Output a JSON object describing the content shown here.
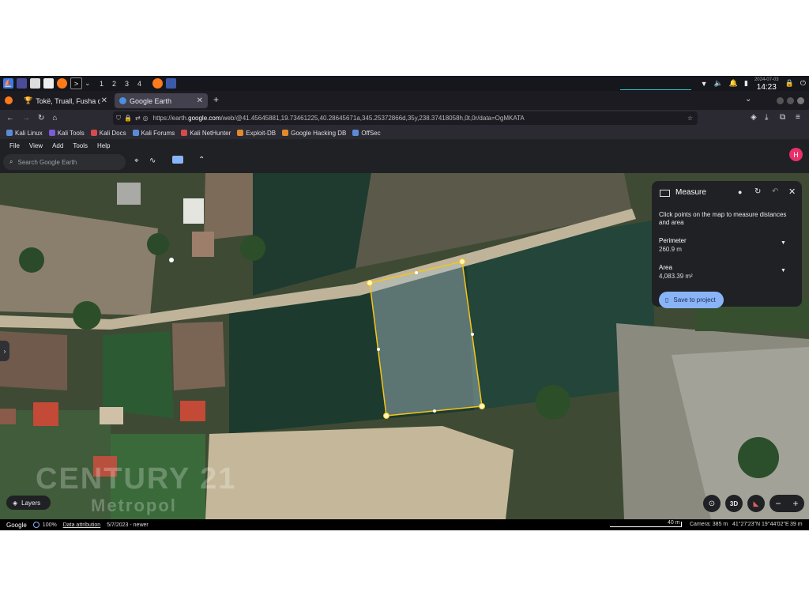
{
  "taskbar": {
    "workspaces": [
      "1",
      "2",
      "3",
      "4"
    ],
    "date": "2024-07-03",
    "time": "14:23"
  },
  "tabs": [
    {
      "label": "Tokë, Truall, Fusha dhe F"
    },
    {
      "label": "Google Earth"
    }
  ],
  "url": {
    "prefix": "https://earth.",
    "domain": "google.com",
    "rest": "/web/@41.45645881,19.73461225,40.28645671a,345.25372866d,35y,238.37418058h,0t,0r/data=OgMKATA"
  },
  "bookmarks": [
    "Kali Linux",
    "Kali Tools",
    "Kali Docs",
    "Kali Forums",
    "Kali NetHunter",
    "Exploit-DB",
    "Google Hacking DB",
    "OffSec"
  ],
  "menu": [
    "File",
    "View",
    "Add",
    "Tools",
    "Help"
  ],
  "search": {
    "placeholder": "Search Google Earth"
  },
  "avatar": "H",
  "measure": {
    "title": "Measure",
    "instructions": "Click points on the map to measure distances and area",
    "perimeter_label": "Perimeter",
    "perimeter_value": "260.9 m",
    "area_label": "Area",
    "area_value": "4,083.39 m²",
    "save_label": "Save to project"
  },
  "map": {
    "layers_label": "Layers",
    "view_3d": "3D",
    "watermark_line1": "CENTURY 21",
    "watermark_line2": "Metropol"
  },
  "status": {
    "brand": "Google",
    "loading": "100%",
    "attribution": "Data attribution",
    "imagery_date": "5/7/2023 - newer",
    "scale": "40 m",
    "camera": "Camera: 385 m",
    "coords": "41°27'23\"N 19°44'02\"E",
    "elevation": "39 m"
  },
  "colors": {
    "accent": "#8ab4f8",
    "polygon": "#f5c518",
    "avatar": "#e8306b"
  }
}
